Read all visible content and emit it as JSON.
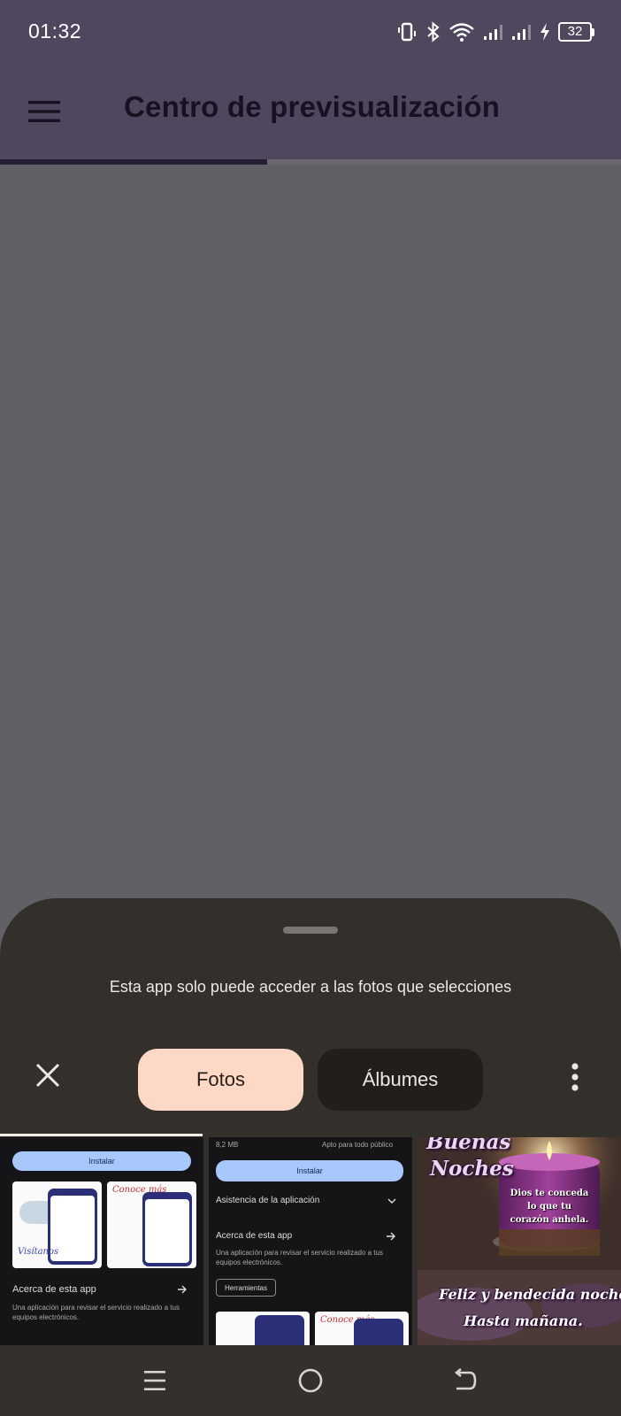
{
  "status_bar": {
    "time": "01:32",
    "battery": "32"
  },
  "app_bar": {
    "title": "Centro de previsualización",
    "progress": 0.43
  },
  "picker": {
    "notice": "Esta app solo puede acceder a las fotos que selecciones",
    "tabs": [
      {
        "label": "Fotos",
        "selected": true
      },
      {
        "label": "Álbumes",
        "selected": false
      }
    ]
  },
  "thumbnails": {
    "first": {
      "install": "Instalar",
      "left_card_text": "Visítanos",
      "right_card_text": "Conoce más",
      "about_title": "Acerca de esta app",
      "about_body": "Una aplicación para revisar el servicio realizado a tus equipos electrónicos."
    },
    "second": {
      "size": "8,2 MB",
      "rating": "Apto para todo público",
      "install": "Instalar",
      "support": "Asistencia de la aplicación",
      "about_title": "Acerca de esta app",
      "about_body": "Una aplicación para revisar el servicio realizado a tus equipos electrónicos.",
      "tag": "Herramientas",
      "card_text": "Conoce más"
    },
    "third": {
      "line1": "Buenas",
      "line2": "Noches",
      "candle_text": "Dios te conceda lo que tu corazón anhela.",
      "line3": "Feliz y bendecida noche.",
      "line4": "Hasta mañana."
    }
  },
  "icons": {
    "menu": "hamburger-icon",
    "close": "close-icon",
    "more": "more-vert-icon",
    "nav_recents": "recents-icon",
    "nav_home": "home-icon",
    "nav_back": "back-icon"
  },
  "colors": {
    "app_bar": "#4f475e",
    "sheet": "#33302c",
    "selected_tab": "#fdd8c6",
    "unselected_tab": "#221e1b"
  }
}
